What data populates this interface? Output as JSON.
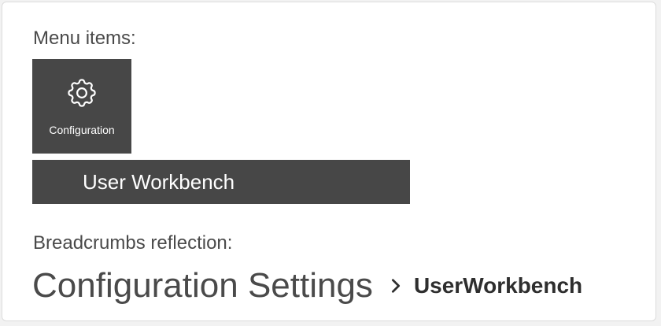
{
  "menu": {
    "heading": "Menu items:",
    "tile": {
      "label": "Configuration",
      "icon": "gear-icon"
    },
    "bar": {
      "label": "User Workbench"
    }
  },
  "breadcrumbs": {
    "heading": "Breadcrumbs reflection:",
    "root": "Configuration Settings",
    "separator_icon": "chevron-right-icon",
    "current": "UserWorkbench"
  },
  "colors": {
    "tile_background": "#474747",
    "page_background": "#ffffff",
    "text": "#4a4a4a"
  }
}
